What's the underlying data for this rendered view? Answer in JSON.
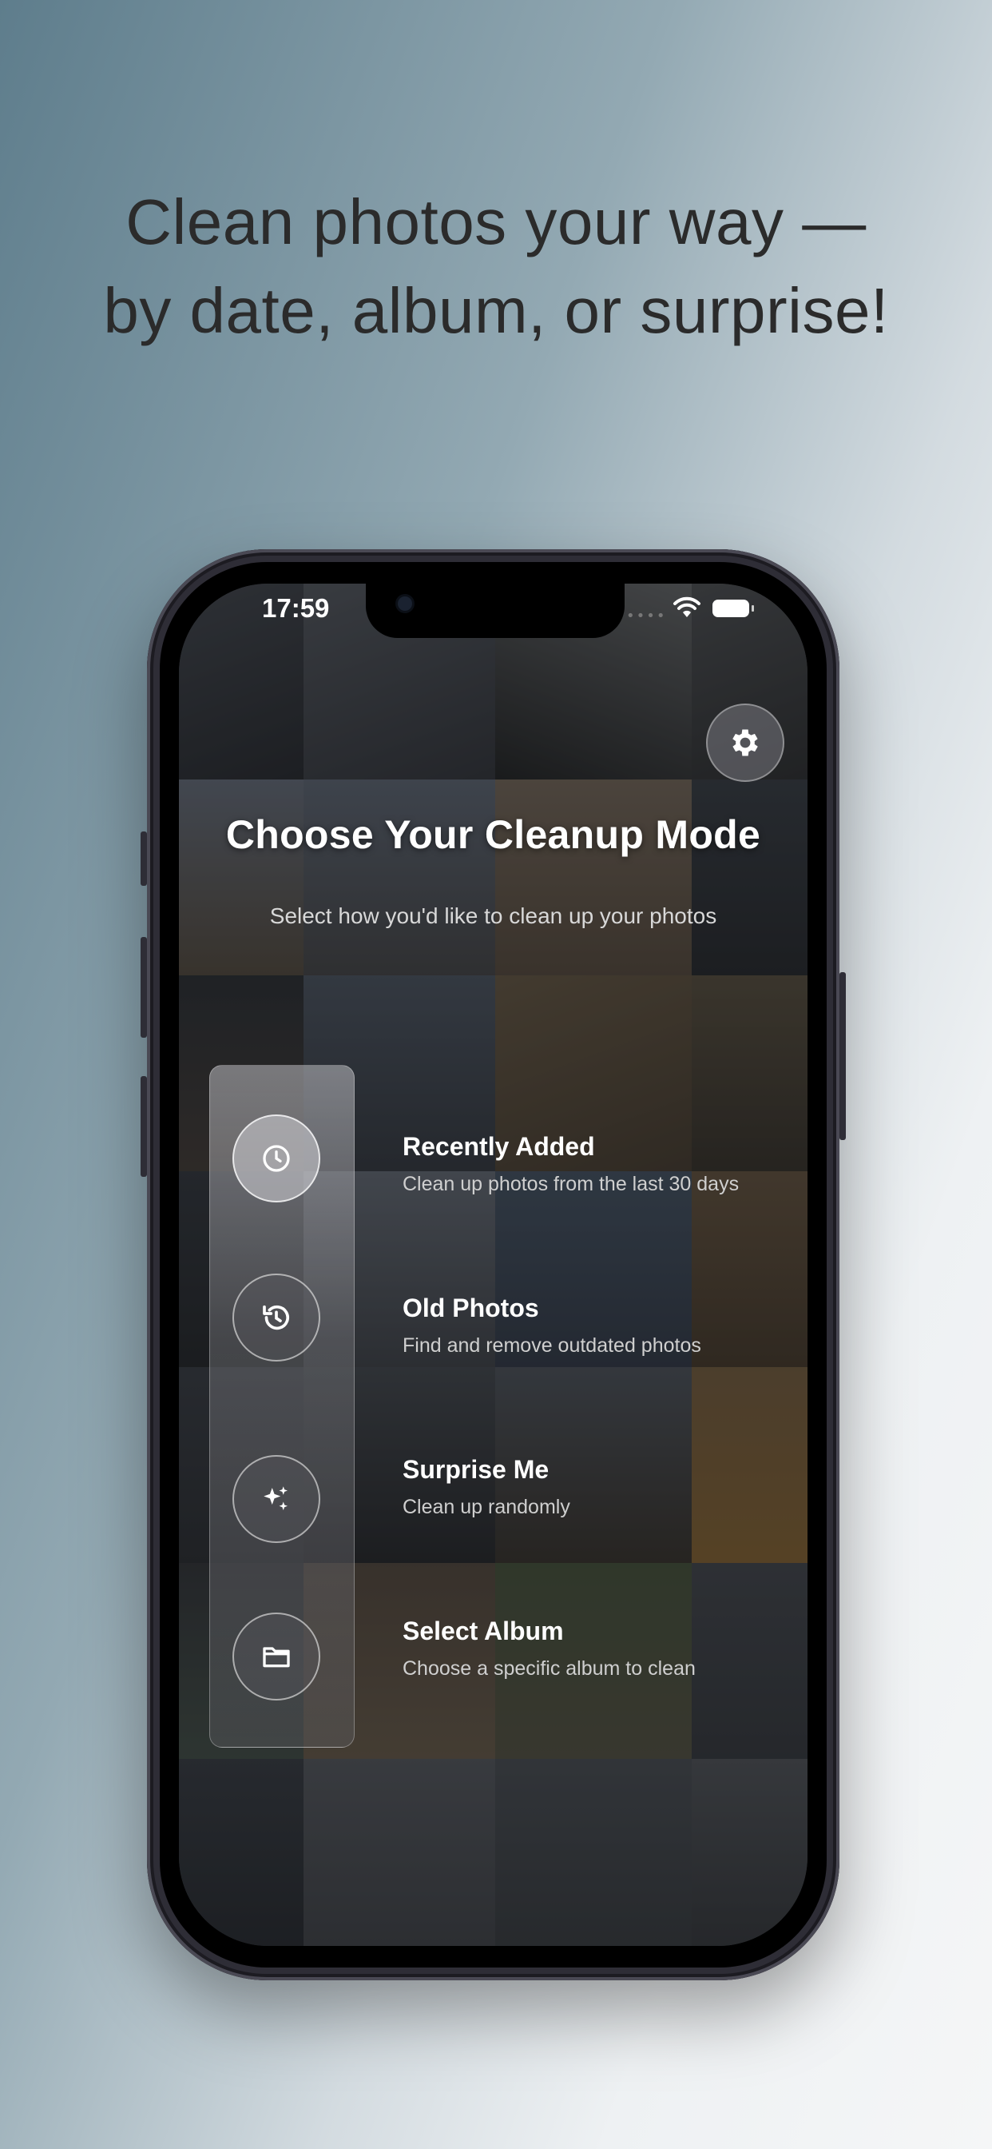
{
  "headline": "Clean photos your way — by date, album, or surprise!",
  "status_bar": {
    "time": "17:59"
  },
  "screen": {
    "title": "Choose Your Cleanup Mode",
    "subtitle": "Select how you'd like to clean up your photos",
    "settings_icon": "gear-icon",
    "modes": [
      {
        "title": "Recently Added",
        "description": "Clean up photos from the last 30 days",
        "icon": "clock-icon",
        "selected": true
      },
      {
        "title": "Old Photos",
        "description": "Find and remove outdated photos",
        "icon": "history-icon",
        "selected": false
      },
      {
        "title": "Surprise Me",
        "description": "Clean up randomly",
        "icon": "sparkles-icon",
        "selected": false
      },
      {
        "title": "Select Album",
        "description": "Choose a specific album to clean",
        "icon": "folder-icon",
        "selected": false
      }
    ]
  },
  "colors": {
    "background_left": "#5e7d8c",
    "background_right": "#f5f6f7",
    "headline": "#2b2b2b",
    "phone_frame": "#2e2d36"
  }
}
